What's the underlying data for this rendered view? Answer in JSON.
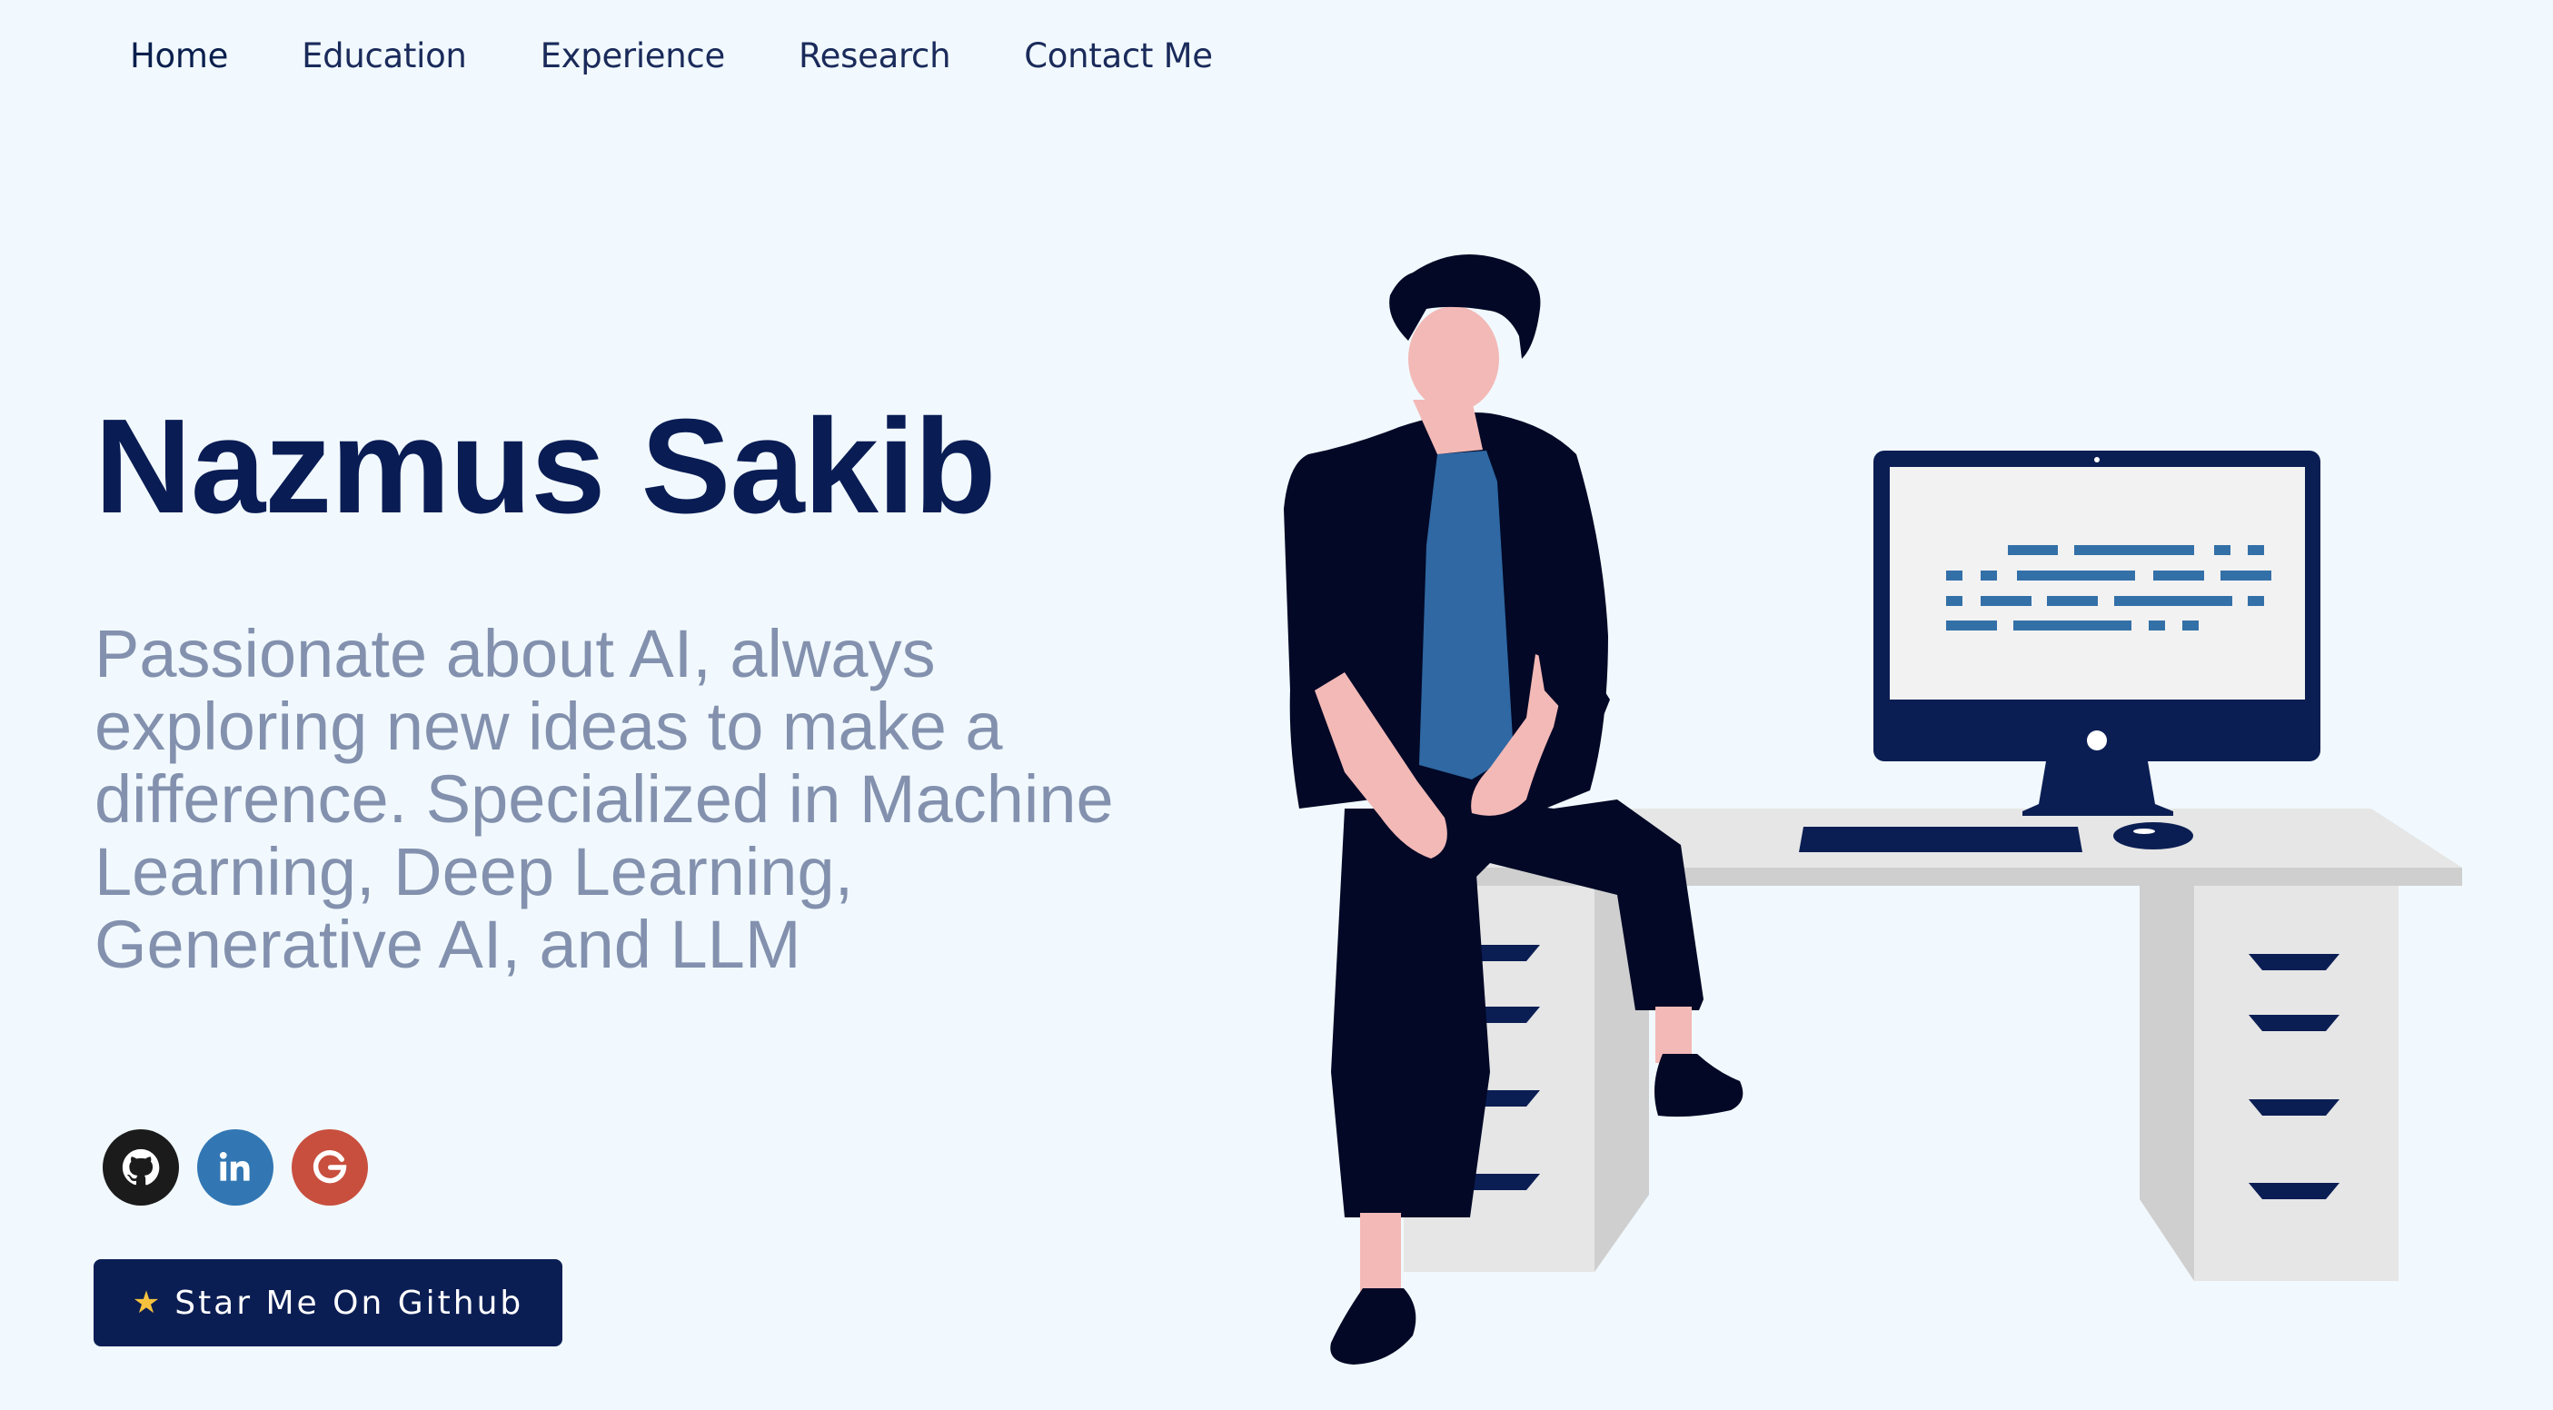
{
  "nav": {
    "items": [
      {
        "label": "Home"
      },
      {
        "label": "Education"
      },
      {
        "label": "Experience"
      },
      {
        "label": "Research"
      },
      {
        "label": "Contact Me"
      }
    ],
    "active": "Home"
  },
  "hero": {
    "name": "Nazmus Sakib",
    "subtitle": "Passionate about AI, always exploring new ideas to make a difference. Specialized in Machine Learning, Deep Learning, Generative AI, and LLM"
  },
  "socials": [
    {
      "icon": "github-icon",
      "color": "#1b1b1b"
    },
    {
      "icon": "linkedin-icon",
      "color": "#3277b3"
    },
    {
      "icon": "google-icon",
      "color": "#c84f3e"
    }
  ],
  "cta": {
    "icon": "star-icon",
    "label": "Star Me On Github"
  },
  "colors": {
    "background": "#f1f9fe",
    "primary": "#0a1c54",
    "subtitle": "#8391ae",
    "accent_blue": "#3470a8"
  },
  "illustration": {
    "icon": "developer-desk-illustration"
  }
}
